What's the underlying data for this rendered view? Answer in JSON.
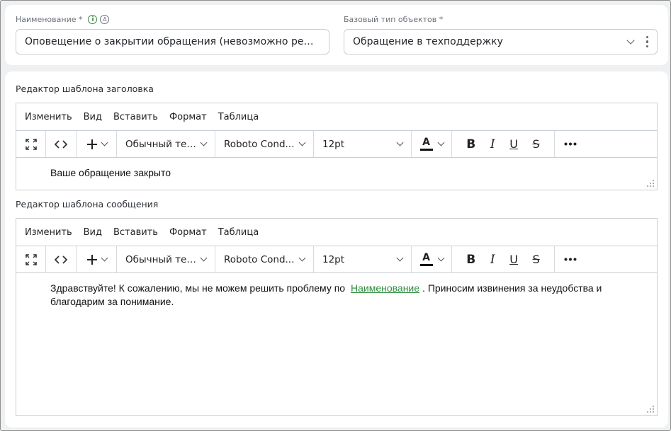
{
  "form": {
    "name_label": "Наименование *",
    "name_value": "Оповещение о закрытии обращения (невозможно решить...",
    "info_icon": "i",
    "auto_icon": "A",
    "base_type_label": "Базовый тип объектов *",
    "base_type_value": "Обращение в техподдержку"
  },
  "editors": [
    {
      "label": "Редактор шаблона заголовка",
      "menu": [
        "Изменить",
        "Вид",
        "Вставить",
        "Формат",
        "Таблица"
      ],
      "block_format": "Обычный тек...",
      "font_family": "Roboto Cond...",
      "font_size": "12pt",
      "content": "Ваше обращение закрыто"
    },
    {
      "label": "Редактор шаблона сообщения",
      "menu": [
        "Изменить",
        "Вид",
        "Вставить",
        "Формат",
        "Таблица"
      ],
      "block_format": "Обычный тек...",
      "font_family": "Roboto Cond...",
      "font_size": "12pt",
      "content_before": "Здравствуйте! К сожалению, мы не можем решить проблему по",
      "content_link": "Наименование",
      "content_after": ". Приносим извинения за неудобства и благодарим за понимание."
    }
  ],
  "icons": {
    "fullscreen": "fullscreen-icon",
    "code": "code-icon",
    "insert": "plus-icon",
    "text_color": "A",
    "bold": "B",
    "italic": "I",
    "underline": "U",
    "strike": "S",
    "more": "more-icon"
  },
  "colors": {
    "accent_green": "#2e8b3e",
    "text_color_bar": "#111111"
  }
}
